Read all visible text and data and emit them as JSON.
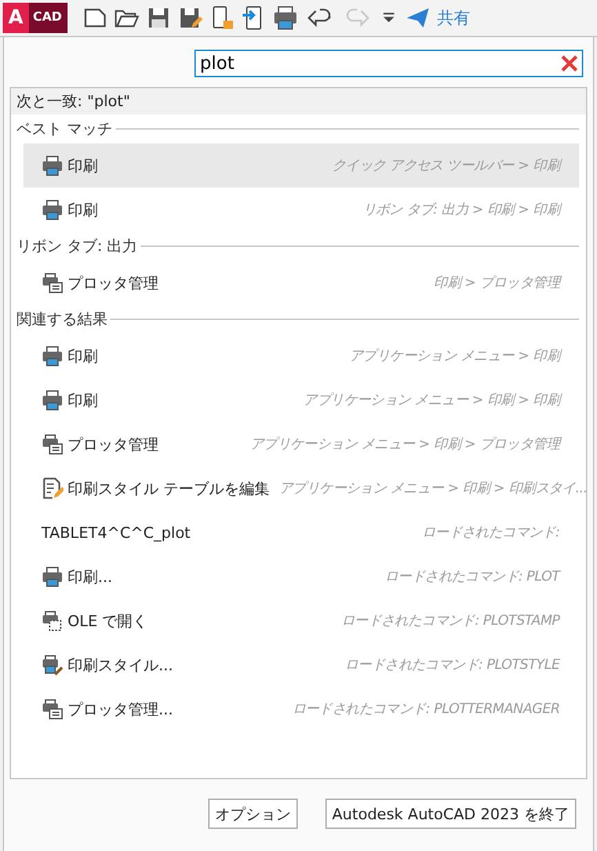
{
  "toolbar": {
    "logo": {
      "letter": "A",
      "text": "CAD"
    },
    "share_label": "共有",
    "redo_disabled": true
  },
  "search": {
    "value": "plot"
  },
  "match_caption": "次と一致: \"plot\"",
  "sections": [
    {
      "title": "ベスト マッチ",
      "rows": [
        {
          "kind": "printer",
          "label": "印刷",
          "path": "クイック アクセス ツールバー > 印刷",
          "selected": true
        },
        {
          "kind": "printer",
          "label": "印刷",
          "path": "リボン タブ: 出力 > 印刷 > 印刷",
          "selected": false
        }
      ]
    },
    {
      "title": "リボン タブ: 出力",
      "rows": [
        {
          "kind": "plotter",
          "label": "プロッタ管理",
          "path": "印刷 > プロッタ管理",
          "selected": false
        }
      ]
    },
    {
      "title": "関連する結果",
      "rows": [
        {
          "kind": "printer",
          "label": "印刷",
          "path": "アプリケーション メニュー > 印刷",
          "selected": false
        },
        {
          "kind": "printer",
          "label": "印刷",
          "path": "アプリケーション メニュー > 印刷 > 印刷",
          "selected": false
        },
        {
          "kind": "plotter",
          "label": "プロッタ管理",
          "path": "アプリケーション メニュー > 印刷 > プロッタ管理",
          "selected": false
        },
        {
          "kind": "edit",
          "label": "印刷スタイル テーブルを編集",
          "path": "アプリケーション メニュー > 印刷 > 印刷スタイ...",
          "selected": false
        },
        {
          "kind": "none",
          "label": "TABLET4^C^C_plot",
          "path": "ロードされたコマンド:",
          "selected": false
        },
        {
          "kind": "printer",
          "label": "印刷...",
          "path": "ロードされたコマンド: PLOT",
          "selected": false
        },
        {
          "kind": "stamp",
          "label": "OLE で開く",
          "path": "ロードされたコマンド: PLOTSTAMP",
          "selected": false
        },
        {
          "kind": "style",
          "label": "印刷スタイル...",
          "path": "ロードされたコマンド: PLOTSTYLE",
          "selected": false
        },
        {
          "kind": "plotter",
          "label": "プロッタ管理...",
          "path": "ロードされたコマンド: PLOTTERMANAGER",
          "selected": false
        }
      ]
    }
  ],
  "buttons": [
    "オプション",
    "Autodesk AutoCAD 2023 を終了"
  ]
}
